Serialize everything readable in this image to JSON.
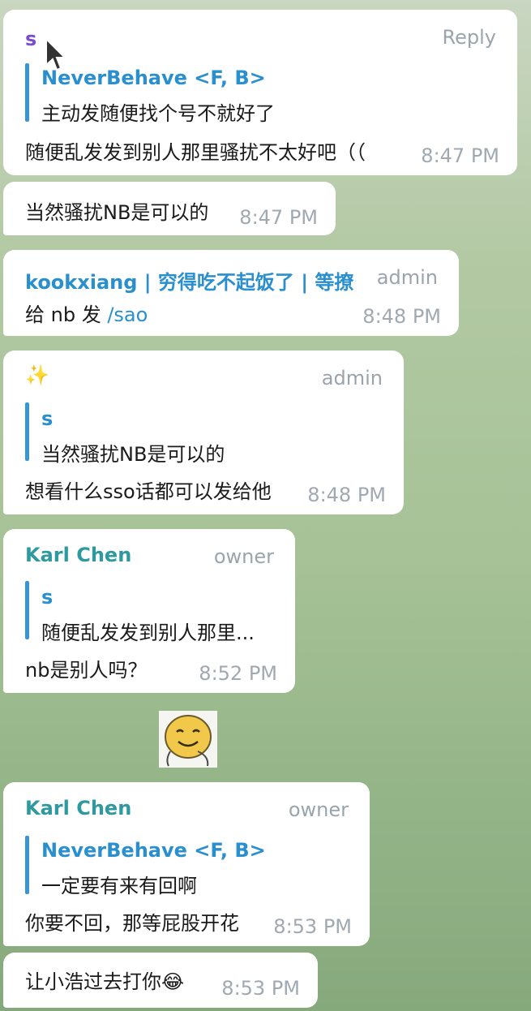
{
  "colors": {
    "bubble": "#ffffff",
    "link_blue": "#2a8fce",
    "teal_name": "#2e9aa0",
    "purple_name": "#7c4dcc",
    "meta_gray": "#9aa4ad"
  },
  "messages": [
    {
      "sender": "s",
      "action": "Reply",
      "quote_name": "NeverBehave <F, B>",
      "quote_text": "主动发随便找个号不就好了",
      "text": "随便乱发发到别人那里骚扰不太好吧（（",
      "time": "8:47 PM"
    },
    {
      "text": "当然骚扰NB是可以的",
      "time": "8:47 PM"
    },
    {
      "sender": "kookxiang | 穷得吃不起饭了 | 等撩",
      "role": "admin",
      "text": "给 nb 发 ",
      "command": "/sao",
      "time": "8:48 PM"
    },
    {
      "sender": "✨",
      "role": "admin",
      "quote_name": "s",
      "quote_text": "当然骚扰NB是可以的",
      "text": "想看什么sso话都可以发给他",
      "time": "8:48 PM"
    },
    {
      "sender": "Karl Chen",
      "role": "owner",
      "quote_name": "s",
      "quote_text": "随便乱发发到别人那里...",
      "text": "nb是别人吗？",
      "time": "8:52 PM"
    },
    {
      "sender": "Karl Chen",
      "role": "owner",
      "quote_name": "NeverBehave <F, B>",
      "quote_text": "一定要有来有回啊",
      "text": "你要不回，那等屁股开花",
      "time": "8:53 PM"
    },
    {
      "text": "让小浩过去打你😂",
      "time": "8:53 PM"
    }
  ]
}
